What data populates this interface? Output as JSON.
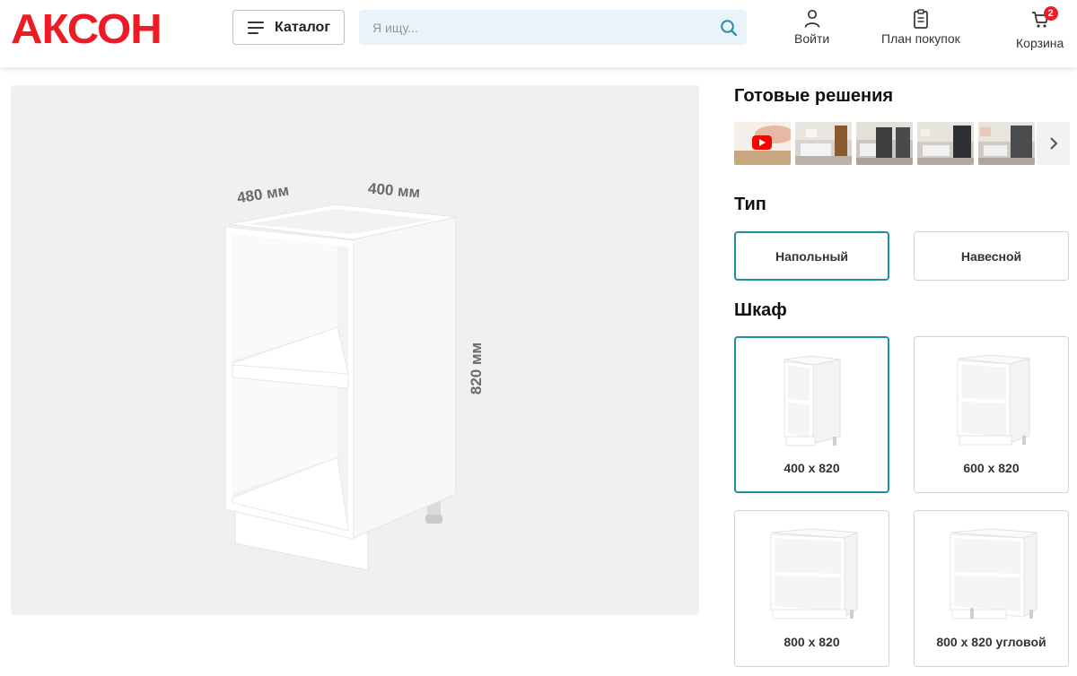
{
  "header": {
    "logo": "АКСОН",
    "catalog_label": "Каталог",
    "search_placeholder": "Я ищу...",
    "login_label": "Войти",
    "plan_label": "План покупок",
    "cart_label": "Корзина",
    "cart_count": "2",
    "brand_color": "#ed1c24"
  },
  "preview": {
    "dim_depth": "480 мм",
    "dim_width": "400 мм",
    "dim_height": "820 мм"
  },
  "ready_solutions": {
    "title": "Готовые решения",
    "thumbnails": [
      "video-thumbnail",
      "kitchen-photo",
      "kitchen-photo",
      "kitchen-photo",
      "kitchen-photo"
    ],
    "next_icon": "chevron-right-icon"
  },
  "type": {
    "title": "Тип",
    "options": [
      {
        "label": "Напольный",
        "selected": true
      },
      {
        "label": "Навесной",
        "selected": false
      }
    ]
  },
  "cabinet": {
    "title": "Шкаф",
    "options": [
      {
        "label": "400 x 820",
        "selected": true
      },
      {
        "label": "600 x 820",
        "selected": false
      },
      {
        "label": "800 x 820",
        "selected": false
      },
      {
        "label": "800 x 820 угловой",
        "selected": false
      }
    ]
  },
  "accent_color": "#1f8ea3"
}
